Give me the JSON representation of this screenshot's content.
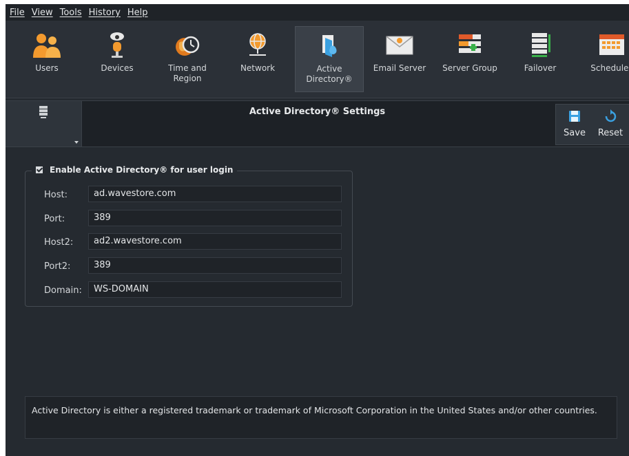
{
  "menu": [
    "File",
    "View",
    "Tools",
    "History",
    "Help"
  ],
  "toolbar": {
    "items": [
      {
        "label": "Users",
        "icon": "users-icon"
      },
      {
        "label": "Devices",
        "icon": "devices-icon"
      },
      {
        "label": "Time and\nRegion",
        "icon": "time-region-icon"
      },
      {
        "label": "Network",
        "icon": "network-icon"
      },
      {
        "label": "Active\nDirectory®",
        "icon": "active-directory-icon",
        "active": true
      },
      {
        "label": "Email Server",
        "icon": "email-server-icon"
      },
      {
        "label": "Server Group",
        "icon": "server-group-icon"
      },
      {
        "label": "Failover",
        "icon": "failover-icon"
      },
      {
        "label": "Schedules",
        "icon": "schedules-icon"
      }
    ]
  },
  "header": {
    "title": "Active Directory® Settings",
    "save_label": "Save",
    "reset_label": "Reset"
  },
  "form": {
    "enable_label": "Enable Active Directory® for user login",
    "enable_checked": true,
    "fields": [
      {
        "label": "Host:",
        "value": "ad.wavestore.com"
      },
      {
        "label": "Port:",
        "value": "389"
      },
      {
        "label": "Host2:",
        "value": "ad2.wavestore.com"
      },
      {
        "label": "Port2:",
        "value": "389"
      },
      {
        "label": "Domain:",
        "value": "WS-DOMAIN"
      }
    ]
  },
  "footer": {
    "note": "Active Directory is either a registered trademark or trademark of Microsoft Corporation in the United States and/or other countries."
  },
  "colors": {
    "background": "#252a30",
    "toolbar": "#2b3037",
    "accent_orange": "#f0932b",
    "accent_blue": "#3aa0e0"
  }
}
